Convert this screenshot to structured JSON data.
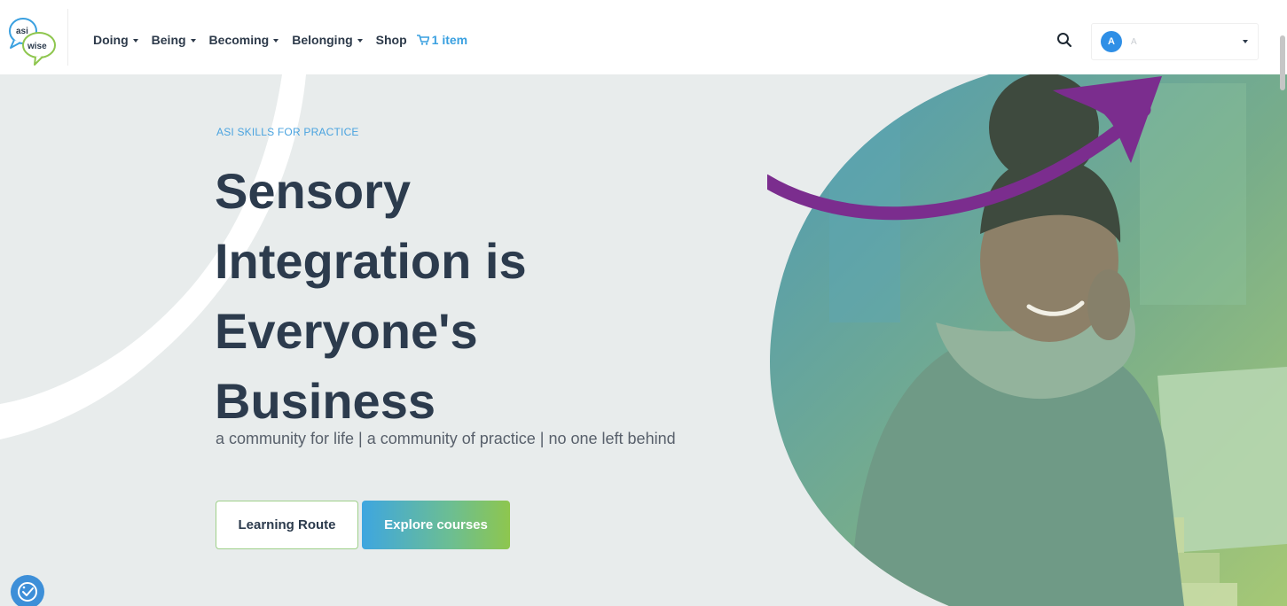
{
  "brand": {
    "logo_word_top": "asi",
    "logo_word_bottom": "wise"
  },
  "nav": {
    "items": [
      {
        "label": "Doing"
      },
      {
        "label": "Being"
      },
      {
        "label": "Becoming"
      },
      {
        "label": "Belonging"
      }
    ],
    "shop_label": "Shop",
    "cart_label": "1 item"
  },
  "user": {
    "avatar_letter": "A",
    "name": "A"
  },
  "hero": {
    "eyebrow": "ASI SKILLS FOR PRACTICE",
    "headline_lines": [
      "Sensory",
      "Integration is",
      "Everyone's",
      "Business"
    ],
    "subtitle": "a community for life | a community of practice | no one left behind",
    "primary_button": "Learning Route",
    "secondary_button": "Explore courses"
  },
  "icons": {
    "search": "search-icon",
    "cart": "cart-icon",
    "accessibility": "accessibility-icon"
  },
  "colors": {
    "accent_blue": "#3aa0e0",
    "heading": "#2c3b4d",
    "gradient_start": "#3ea6e0",
    "gradient_end": "#8ec64e",
    "annotation_arrow": "#7b2d8e"
  }
}
